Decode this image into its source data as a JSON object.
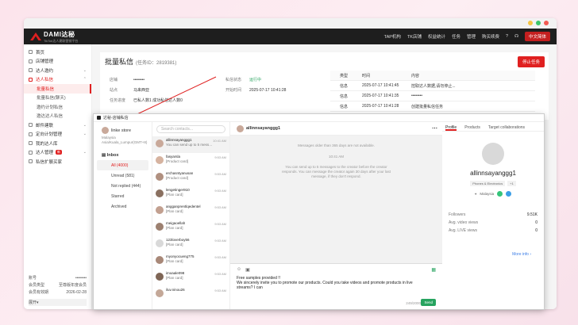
{
  "header": {
    "brand": "DAMI达秘",
    "slogan": "TikTok达人建联营销平台",
    "nav": [
      "TAP机构",
      "TK店铺",
      "权益统计",
      "任务",
      "管理",
      "购买续费"
    ],
    "lang": "中文简体"
  },
  "sidebar": {
    "items": [
      {
        "label": "首页"
      },
      {
        "label": "店铺管理"
      },
      {
        "label": "达人邀约"
      },
      {
        "label": "达人私信"
      }
    ],
    "sub": [
      "批量私信",
      "批量私信(聊天)",
      "邀约计划私信",
      "邀达达人私信"
    ],
    "items2": [
      {
        "label": "邮件建联"
      },
      {
        "label": "定向计划管理"
      },
      {
        "label": "我的达人库"
      },
      {
        "label": "达人管理",
        "badge": "新"
      },
      {
        "label": "私信扩展买家"
      }
    ],
    "footer": [
      {
        "k": "账号",
        "v": "••••••••"
      },
      {
        "k": "会员类型",
        "v": "至尊版年度会员"
      },
      {
        "k": "会员有效期",
        "v": "2026-02-28"
      }
    ],
    "expand": "展开▾"
  },
  "page": {
    "title": "批量私信",
    "task": "(任务ID：2819381)",
    "stop": "停止任务",
    "labels1": [
      "店铺",
      "站点",
      "任务进度"
    ],
    "vals1": [
      "••••••••",
      "马来西亚",
      "已私人数1  成功私信达人数0"
    ],
    "labels2": [
      "私信状态",
      "开始时间"
    ],
    "vals2": [
      "运行中",
      "2025-07-17 10:41:28"
    ],
    "table": {
      "head": [
        "类型",
        "时间",
        "内容"
      ],
      "rows": [
        [
          "信息",
          "2025-07-17 10:41:45",
          "控取达人数据,请勿停止..."
        ],
        [
          "信息",
          "2025-07-17 10:41:35",
          "••••••••"
        ],
        [
          "信息",
          "2025-07-17 10:41:28",
          "创建批量私信任务"
        ]
      ]
    }
  },
  "chat": {
    "title": "达秘-店铺私信",
    "store": "linke store",
    "loc": [
      "Malaysia",
      "Asia/Kuala_Lumpur(GMT+8)"
    ],
    "inbox": "Inbox",
    "filters": [
      "All (4000)",
      "Unread (581)",
      "Not replied (444)",
      "Starred",
      "Archived"
    ],
    "search": "Search contacts...",
    "contacts": [
      {
        "n": "allinnsayanggg1",
        "p": "You can send up to 5 message...",
        "t": "10:41 AM"
      },
      {
        "n": "fasyarsla",
        "p": "[Product card]",
        "t": "9:53 AM"
      },
      {
        "n": "erchasntyanusan",
        "p": "[Product card]",
        "t": "9:53 AM"
      },
      {
        "n": "lengetinger910",
        "p": "[Plan card]",
        "t": "9:53 AM"
      },
      {
        "n": "angganprentlqedentel",
        "p": "[Plan card]",
        "t": "9:53 AM"
      },
      {
        "n": "meigaoellah",
        "p": "[Plan card]",
        "t": "9:53 AM"
      },
      {
        "n": "123loverboy56",
        "p": "[Plan card]",
        "t": "9:53 AM"
      },
      {
        "n": "myonyocueng775",
        "p": "[Plan card]",
        "t": "9:53 AM"
      },
      {
        "n": "imoaale098",
        "p": "[Plan card]",
        "t": "9:53 AM"
      },
      {
        "n": "iluv.ninou26",
        "p": "",
        "t": "9:53 AM"
      }
    ],
    "conv": {
      "name": "allinnsayanggg1",
      "notice": "Messages older than 365 days are not available.",
      "time": "10:41 AM",
      "sys": "You can send up to 5 messages to the creator before the creator responds. You can message the creator again 30 days after your last message, if they don't respond.",
      "draft": "Free samples provided !!\nWe sincerely invite you to promote our products. Could you take videos and promote products in live streams? I can",
      "count": "249/2000",
      "send": "Send"
    },
    "profile": {
      "tabs": [
        "Profile",
        "Products",
        "Target collaborations"
      ],
      "name": "allinnsayanggg1",
      "tags": [
        "Phones & Electronics",
        "+1"
      ],
      "loc": "Malaysia",
      "stats": [
        [
          "Followers",
          "9.51K"
        ],
        [
          "Avg. video views",
          "0"
        ],
        [
          "Avg. LIVE views",
          "0"
        ]
      ],
      "more": "More info"
    }
  }
}
